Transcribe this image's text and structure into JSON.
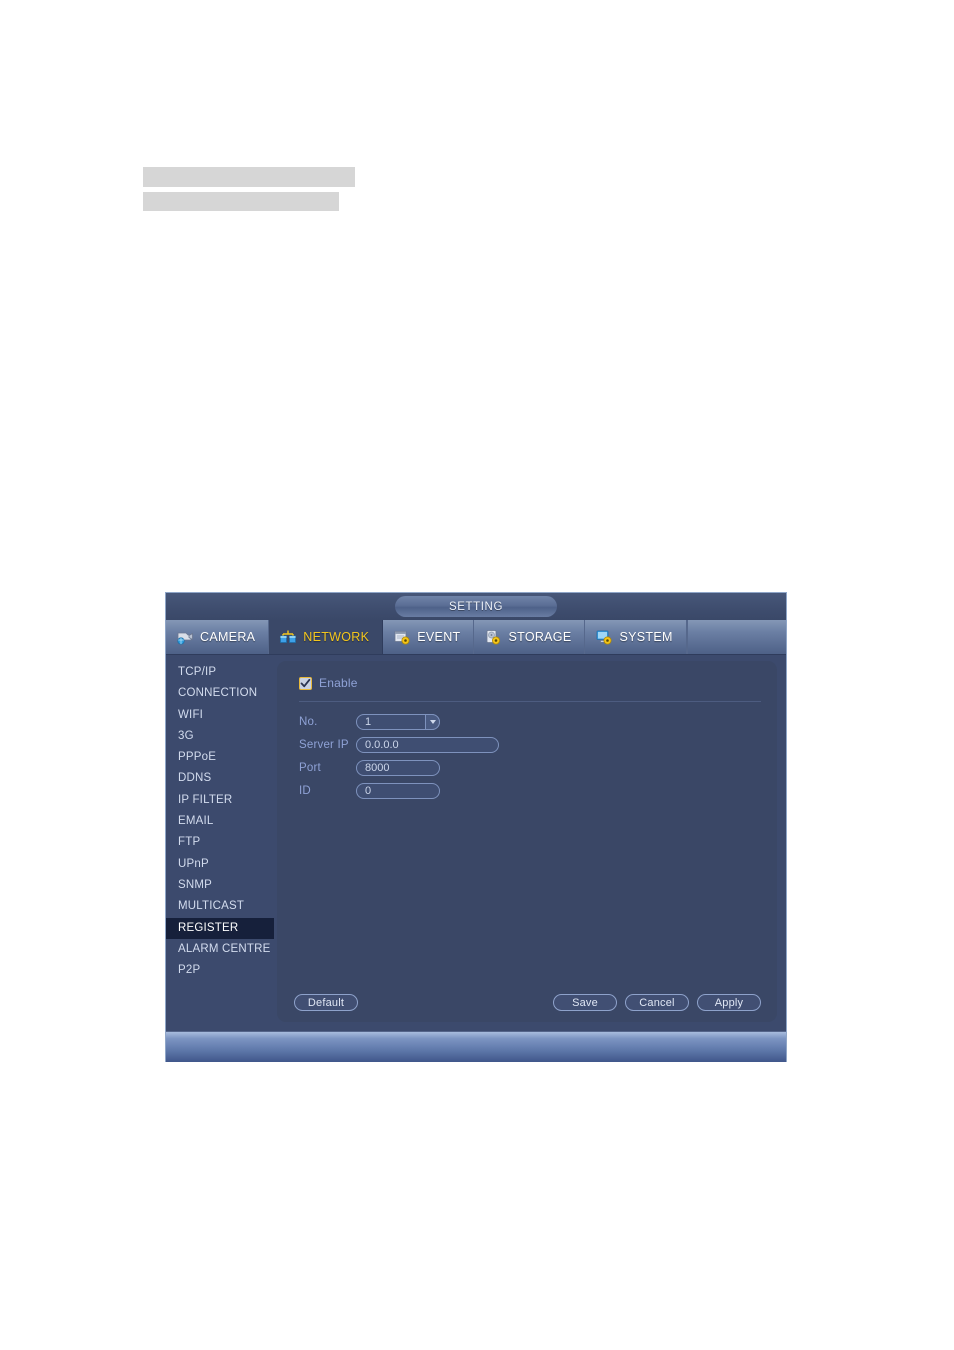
{
  "document": {
    "redacted_bars": 2
  },
  "window": {
    "title": "SETTING"
  },
  "tabs": [
    {
      "label": "CAMERA",
      "icon": "camera-icon",
      "active": false
    },
    {
      "label": "NETWORK",
      "icon": "network-icon",
      "active": true
    },
    {
      "label": "EVENT",
      "icon": "event-icon",
      "active": false
    },
    {
      "label": "STORAGE",
      "icon": "storage-icon",
      "active": false
    },
    {
      "label": "SYSTEM",
      "icon": "system-icon",
      "active": false
    }
  ],
  "sidebar": {
    "items": [
      {
        "label": "TCP/IP",
        "selected": false
      },
      {
        "label": "CONNECTION",
        "selected": false
      },
      {
        "label": "WIFI",
        "selected": false
      },
      {
        "label": "3G",
        "selected": false
      },
      {
        "label": "PPPoE",
        "selected": false
      },
      {
        "label": "DDNS",
        "selected": false
      },
      {
        "label": "IP FILTER",
        "selected": false
      },
      {
        "label": "EMAIL",
        "selected": false
      },
      {
        "label": "FTP",
        "selected": false
      },
      {
        "label": "UPnP",
        "selected": false
      },
      {
        "label": "SNMP",
        "selected": false
      },
      {
        "label": "MULTICAST",
        "selected": false
      },
      {
        "label": "REGISTER",
        "selected": true
      },
      {
        "label": "ALARM CENTRE",
        "selected": false
      },
      {
        "label": "P2P",
        "selected": false
      }
    ]
  },
  "form": {
    "enable": {
      "label": "Enable",
      "checked": true
    },
    "no": {
      "label": "No.",
      "value": "1"
    },
    "server_ip": {
      "label": "Server IP",
      "value": "0.0.0.0"
    },
    "port": {
      "label": "Port",
      "value": "8000"
    },
    "id": {
      "label": "ID",
      "value": "0"
    }
  },
  "buttons": {
    "default": "Default",
    "save": "Save",
    "cancel": "Cancel",
    "apply": "Apply"
  },
  "colors": {
    "window_bg": "#3c4a6d",
    "panel_bg": "#3a4766",
    "selected_item_bg": "#16203b",
    "active_tab_text": "#f3c61e",
    "label_text": "#8fa2d6",
    "checkbox_border": "#e8b93a",
    "redact_bar": "#d6d6d6"
  }
}
